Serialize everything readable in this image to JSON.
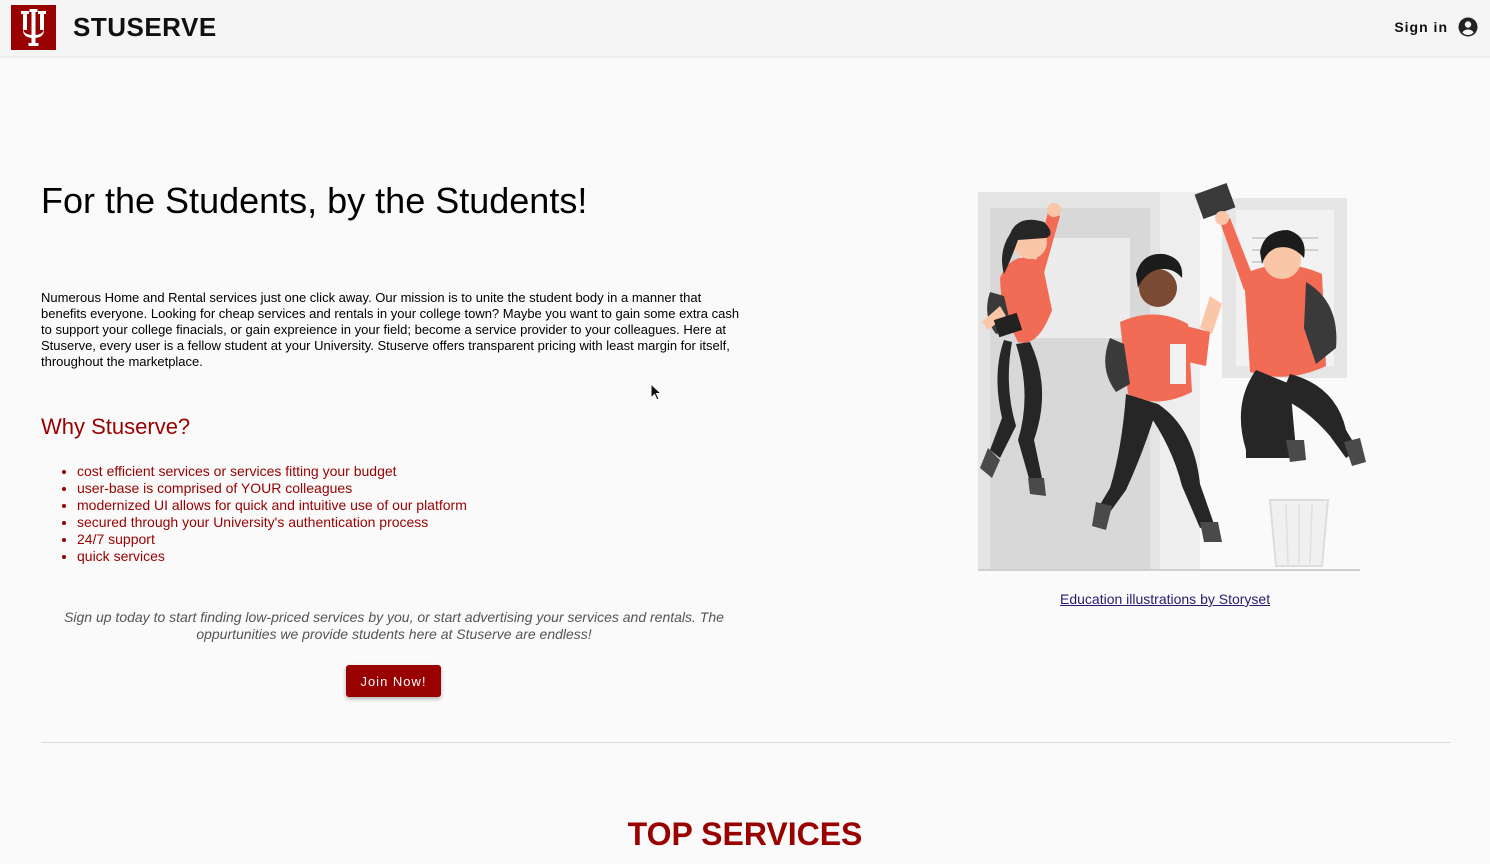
{
  "header": {
    "brand": "STUSERVE",
    "sign_in_label": "Sign in",
    "logo_icon": "iu-trident-logo",
    "account_icon": "account-circle-icon",
    "brand_color": "#990000"
  },
  "hero": {
    "title": "For the Students, by the Students!",
    "intro": "Numerous Home and Rental services just one click away. Our mission is to unite the student body in a manner that benefits everyone. Looking for cheap services and rentals in your college town? Maybe you want to gain some extra cash to support your college finacials, or gain expreience in your field; become a service provider to your colleagues. Here at Stuserve, every user is a fellow student at your University. Stuserve offers transparent pricing with least margin for itself, throughout the marketplace."
  },
  "why": {
    "title": "Why Stuserve?",
    "items": [
      "cost efficient services or services fitting your budget",
      "user-base is comprised of YOUR colleagues",
      "modernized UI allows for quick and intuitive use of our platform",
      "secured through your University's authentication process",
      "24/7 support",
      "quick services"
    ]
  },
  "signup": {
    "note": "Sign up today to start finding low-priced services by you, or start advertising your services and rentals. The oppurtunities we provide students here at Stuserve are endless!",
    "button_label": "Join Now!"
  },
  "illustration": {
    "credit_link": "Education illustrations by Storyset",
    "accent_color": "#f26b55"
  },
  "top_services": {
    "title": "TOP SERVICES"
  }
}
